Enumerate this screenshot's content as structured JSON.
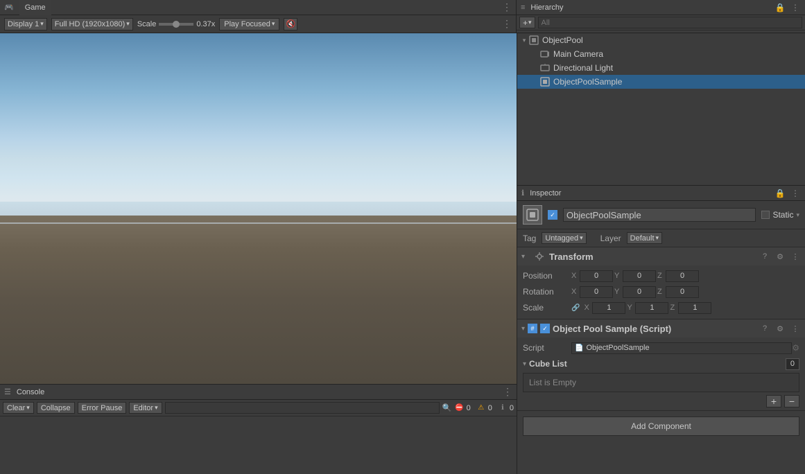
{
  "app": {
    "title": "Game",
    "dots_icon": "⋮"
  },
  "game_tab": {
    "label": "Game",
    "icon": "🎮"
  },
  "game_controls": {
    "display": "Display 1",
    "resolution": "Full HD (1920x1080)",
    "scale_label": "Scale",
    "scale_value": "0.37x",
    "play_focused": "Play Focused",
    "mute_icon": "🔇"
  },
  "hierarchy": {
    "tab_label": "Hierarchy",
    "search_placeholder": "All",
    "add_btn": "+",
    "items": [
      {
        "label": "ObjectPool",
        "level": 0,
        "has_arrow": true,
        "icon": "▸",
        "type": "root"
      },
      {
        "label": "Main Camera",
        "level": 1,
        "has_arrow": false,
        "icon": "📷",
        "type": "camera"
      },
      {
        "label": "Directional Light",
        "level": 1,
        "has_arrow": false,
        "icon": "💡",
        "type": "light"
      },
      {
        "label": "ObjectPoolSample",
        "level": 1,
        "has_arrow": false,
        "icon": "📦",
        "type": "object",
        "selected": true
      }
    ]
  },
  "inspector": {
    "tab_label": "Inspector",
    "object_name": "ObjectPoolSample",
    "static_label": "Static",
    "tag_label": "Tag",
    "tag_value": "Untagged",
    "layer_label": "Layer",
    "layer_value": "Default",
    "transform": {
      "title": "Transform",
      "position_label": "Position",
      "rotation_label": "Rotation",
      "scale_label": "Scale",
      "position": {
        "x": "0",
        "y": "0",
        "z": "0"
      },
      "rotation": {
        "x": "0",
        "y": "0",
        "z": "0"
      },
      "scale": {
        "x": "1",
        "y": "1",
        "z": "1"
      }
    },
    "script_component": {
      "title": "Object Pool Sample (Script)",
      "script_label": "Script",
      "script_value": "ObjectPoolSample",
      "cube_list_label": "Cube List",
      "cube_list_count": "0",
      "list_empty_text": "List is Empty",
      "add_btn": "+",
      "remove_btn": "−"
    },
    "add_component_label": "Add Component"
  },
  "console": {
    "tab_label": "Console",
    "clear_label": "Clear",
    "collapse_label": "Collapse",
    "error_pause_label": "Error Pause",
    "editor_label": "Editor",
    "search_placeholder": "",
    "error_count": "0",
    "warn_count": "0",
    "info_count": "0"
  }
}
